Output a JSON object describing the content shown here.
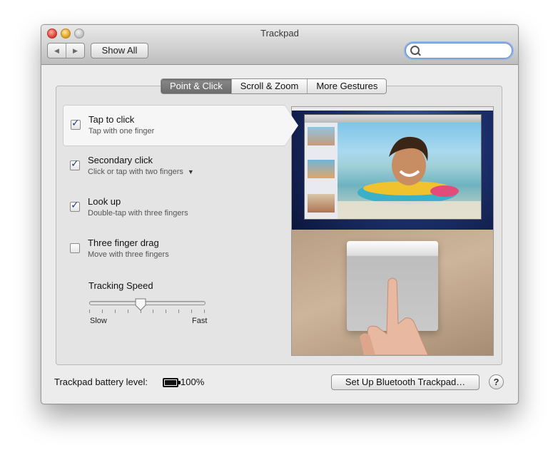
{
  "window": {
    "title": "Trackpad",
    "back_icon": "◀",
    "forward_icon": "▶",
    "show_all_label": "Show All",
    "search": {
      "value": "",
      "placeholder": ""
    }
  },
  "tabs": [
    {
      "label": "Point & Click",
      "active": true
    },
    {
      "label": "Scroll & Zoom",
      "active": false
    },
    {
      "label": "More Gestures",
      "active": false
    }
  ],
  "options": [
    {
      "title": "Tap to click",
      "subtitle": "Tap with one finger",
      "checked": true,
      "selected": true
    },
    {
      "title": "Secondary click",
      "subtitle": "Click or tap with two fingers",
      "checked": true,
      "selected": false,
      "has_menu": true
    },
    {
      "title": "Look up",
      "subtitle": "Double-tap with three fingers",
      "checked": true,
      "selected": false
    },
    {
      "title": "Three finger drag",
      "subtitle": "Move with three fingers",
      "checked": false,
      "selected": false
    }
  ],
  "tracking": {
    "label": "Tracking Speed",
    "min_label": "Slow",
    "max_label": "Fast",
    "tick_count": 10,
    "value_fraction": 0.45
  },
  "footer": {
    "battery_label": "Trackpad battery level:",
    "battery_value": "100%",
    "bluetooth_button": "Set Up Bluetooth Trackpad…",
    "help_label": "?"
  },
  "colors": {
    "checkmark": "#1e3f86",
    "search_focus": "#8fb3e6"
  }
}
